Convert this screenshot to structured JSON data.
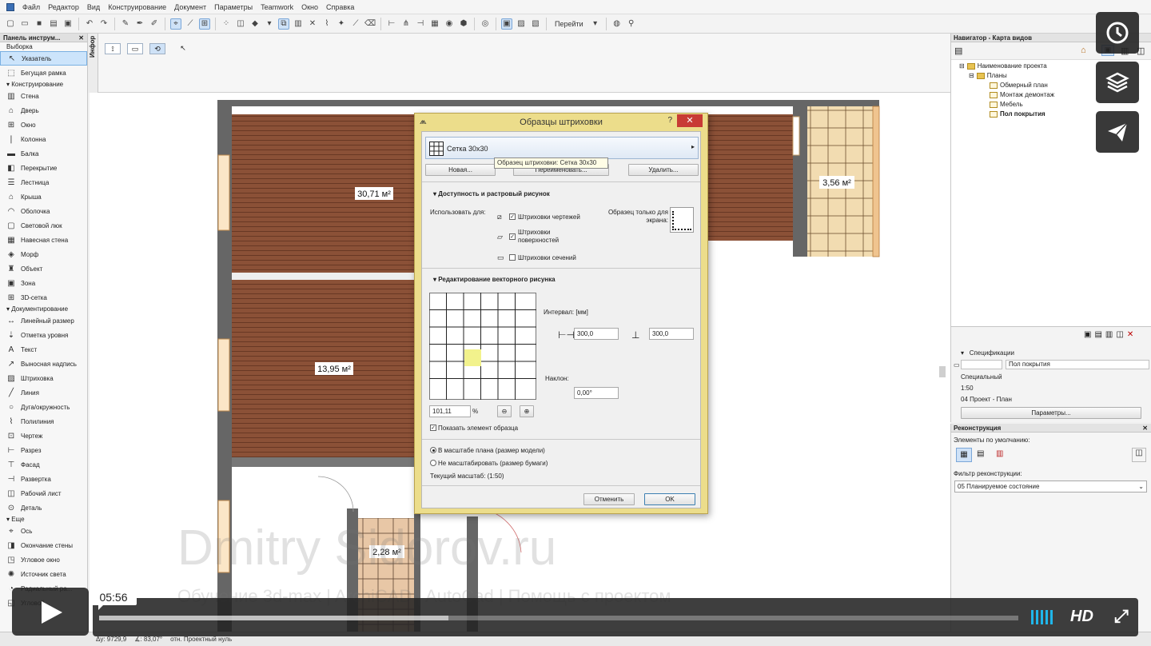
{
  "menu": [
    "Файл",
    "Редактор",
    "Вид",
    "Конструирование",
    "Документ",
    "Параметры",
    "Teamwork",
    "Окно",
    "Справка"
  ],
  "toolbar": {
    "go_label": "Перейти"
  },
  "toolbox": {
    "title": "Панель инструм...",
    "selection_group": "Выборка",
    "selection_items": [
      "Указатель",
      "Бегущая рамка"
    ],
    "construction_group": "Конструирование",
    "construction_items": [
      "Стена",
      "Дверь",
      "Окно",
      "Колонна",
      "Балка",
      "Перекрытие",
      "Лестница",
      "Крыша",
      "Оболочка",
      "Световой люк",
      "Навесная стена",
      "Морф",
      "Объект",
      "Зона",
      "3D-сетка"
    ],
    "documentation_group": "Документирование",
    "documentation_items": [
      "Линейный размер",
      "Отметка уровня",
      "Текст",
      "Выносная надпись",
      "Штриховка",
      "Линия",
      "Дуга/окружность",
      "Полилиния",
      "Чертеж",
      "Разрез",
      "Фасад",
      "Развертка",
      "Рабочий лист",
      "Деталь"
    ],
    "more_group": "Еще",
    "more_items": [
      "Ось",
      "Окончание стены",
      "Угловое окно",
      "Источник света",
      "Радиальный ра...",
      "Угловой..."
    ]
  },
  "info_label": "Инфор",
  "canvas": {
    "areas": [
      "30,71 м²",
      "13,95 м²",
      "3,56 м²",
      "2,28 м²"
    ]
  },
  "navigator": {
    "title": "Навигатор - Карта видов",
    "project": "Наименование проекта",
    "plans": "Планы",
    "views": [
      "Обмерный план",
      "Монтаж демонтаж",
      "Мебель",
      "Пол покрытия"
    ]
  },
  "specs": {
    "title": "Спецификации",
    "name_value": "Пол покрытия",
    "layer": "Специальный",
    "scale": "1:50",
    "pen": "04 Проект - План",
    "params_button": "Параметры..."
  },
  "recon": {
    "title": "Реконструкция",
    "defaults_label": "Элементы по умолчанию:",
    "filter_label": "Фильтр реконструкции:",
    "filter_value": "05 Планируемое состояние"
  },
  "dialog": {
    "title": "Образцы штриховки",
    "help": "?",
    "close": "✕",
    "pattern_name": "Сетка 30x30",
    "btn_new": "Новая...",
    "btn_rename": "Переименовать...",
    "btn_delete": "Удалить...",
    "section_avail": "Доступность и растровый рисунок",
    "use_for": "Использовать для:",
    "use_draft": "Штриховки чертежей",
    "use_surface": "Штриховки поверхностей",
    "use_section": "Штриховки сечений",
    "screen_sample": "Образец только для экрана:",
    "section_vector": "Редактирование векторного рисунка",
    "interval_label": "Интервал: [мм]",
    "interval_x": "300,0",
    "interval_y": "300,0",
    "angle_label": "Наклон:",
    "angle_value": "0,00°",
    "zoom_value": "101,11",
    "zoom_unit": "%",
    "show_sample": "Показать элемент образца",
    "radio_model": "В масштабе плана (размер модели)",
    "radio_paper": "Не масштабировать (размер бумаги)",
    "current_scale": "Текущий масштаб: (1:50)",
    "btn_cancel": "Отменить",
    "btn_ok": "OK"
  },
  "tooltip": "Образец штриховки: Сетка 30x30",
  "watermark": "Dmitry Sidorov.ru",
  "watermark_sub": "Обучение 3d-max | ArchiCAD | AutoCad | Помощь с проектом",
  "status": {
    "az": "Δу: 9729,9",
    "angle": "∡: 83,07°",
    "zero": "отн. Проектный нуль"
  },
  "player": {
    "time": "05:56",
    "progress": 0.38,
    "hd": "HD"
  },
  "colors": {
    "accent": "#20b6ea",
    "dialog_frame": "#ecdd8b",
    "floor_wood": "#8b5137"
  }
}
